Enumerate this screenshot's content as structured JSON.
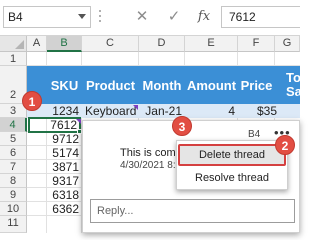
{
  "formula_bar": {
    "name_box": "B4",
    "cancel_icon": "✕",
    "enter_icon": "✓",
    "fx_label": "fx",
    "formula_value": "7612"
  },
  "columns": [
    "A",
    "B",
    "C",
    "D",
    "E",
    "F",
    "G"
  ],
  "rows": [
    "1",
    "2",
    "3",
    "4",
    "5",
    "6",
    "7",
    "8",
    "9",
    "10",
    "11"
  ],
  "table": {
    "headers": {
      "sku": "SKU",
      "product": "Product",
      "month": "Month",
      "amount": "Amount",
      "price": "Price",
      "total_line1": "To",
      "total_line2": "Sa"
    },
    "row3": {
      "sku": "1234",
      "product": "Keyboard",
      "month": "Jan-21",
      "amount": "4",
      "price": "$35"
    },
    "skus": [
      "7612",
      "9712",
      "5174",
      "3871",
      "9317",
      "6318",
      "6362"
    ]
  },
  "comment_thread": {
    "cell_ref": "B4",
    "more_icon": "•••",
    "text": "This is comm",
    "date": "4/30/2021 8:3",
    "reply_placeholder": "Reply..."
  },
  "context_menu": {
    "items": [
      "Delete thread",
      "Resolve thread"
    ]
  },
  "markers": [
    "1",
    "2",
    "3"
  ],
  "colors": {
    "header_fill": "#3b8fd6",
    "row_highlight": "#dce9f7",
    "excel_green": "#217346",
    "marker_red": "#e24e43",
    "comment_indicator": "#7d3ec2"
  }
}
